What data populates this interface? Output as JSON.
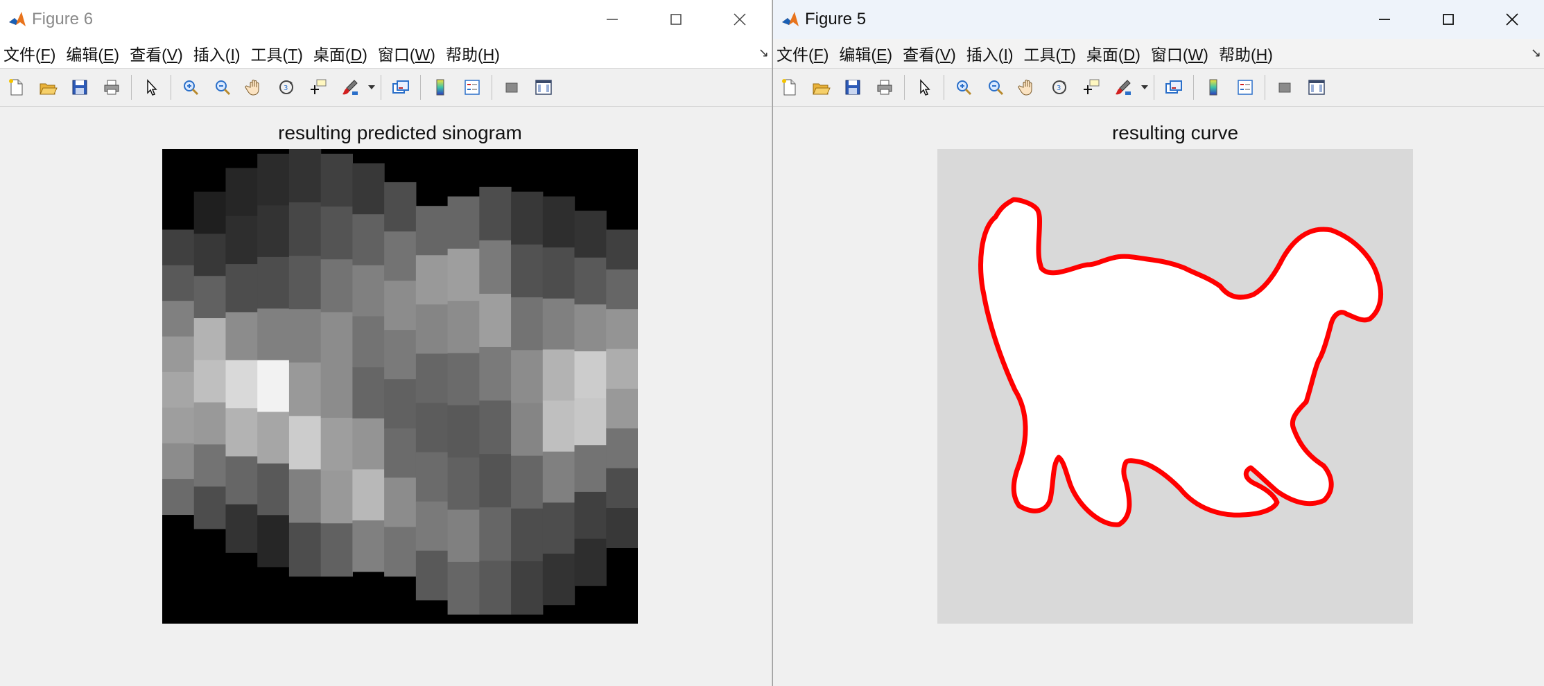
{
  "left_window": {
    "title": "Figure 6",
    "menu": [
      {
        "pre": "文件(",
        "key": "F",
        "post": ")"
      },
      {
        "pre": "编辑(",
        "key": "E",
        "post": ")"
      },
      {
        "pre": "查看(",
        "key": "V",
        "post": ")"
      },
      {
        "pre": "插入(",
        "key": "I",
        "post": ")"
      },
      {
        "pre": "工具(",
        "key": "T",
        "post": ")"
      },
      {
        "pre": "桌面(",
        "key": "D",
        "post": ")"
      },
      {
        "pre": "窗口(",
        "key": "W",
        "post": ")"
      },
      {
        "pre": "帮助(",
        "key": "H",
        "post": ")"
      }
    ],
    "plot_title": "resulting predicted sinogram",
    "sinogram": {
      "colormap": "gray",
      "columns": [
        {
          "top": 0.17,
          "bottom": 0.77,
          "bands": [
            0.25,
            0.35,
            0.5,
            0.6,
            0.65,
            0.62,
            0.55,
            0.42
          ]
        },
        {
          "top": 0.09,
          "bottom": 0.8,
          "bands": [
            0.12,
            0.22,
            0.38,
            0.7,
            0.75,
            0.6,
            0.45,
            0.3
          ]
        },
        {
          "top": 0.04,
          "bottom": 0.85,
          "bands": [
            0.15,
            0.18,
            0.3,
            0.55,
            0.85,
            0.7,
            0.4,
            0.2
          ]
        },
        {
          "top": 0.01,
          "bottom": 0.88,
          "bands": [
            0.17,
            0.2,
            0.3,
            0.5,
            0.95,
            0.65,
            0.35,
            0.15
          ]
        },
        {
          "top": 0.0,
          "bottom": 0.9,
          "bands": [
            0.2,
            0.28,
            0.35,
            0.5,
            0.6,
            0.8,
            0.5,
            0.3
          ]
        },
        {
          "top": 0.01,
          "bottom": 0.9,
          "bands": [
            0.25,
            0.33,
            0.45,
            0.55,
            0.55,
            0.62,
            0.6,
            0.38
          ]
        },
        {
          "top": 0.03,
          "bottom": 0.89,
          "bands": [
            0.22,
            0.38,
            0.5,
            0.45,
            0.4,
            0.58,
            0.72,
            0.5
          ]
        },
        {
          "top": 0.07,
          "bottom": 0.9,
          "bands": [
            0.3,
            0.45,
            0.55,
            0.48,
            0.38,
            0.42,
            0.55,
            0.45
          ]
        },
        {
          "top": 0.12,
          "bottom": 0.95,
          "bands": [
            0.4,
            0.6,
            0.52,
            0.4,
            0.36,
            0.42,
            0.48,
            0.35
          ]
        },
        {
          "top": 0.1,
          "bottom": 0.98,
          "bands": [
            0.4,
            0.62,
            0.55,
            0.42,
            0.35,
            0.38,
            0.5,
            0.4
          ]
        },
        {
          "top": 0.08,
          "bottom": 0.98,
          "bands": [
            0.3,
            0.48,
            0.62,
            0.48,
            0.38,
            0.33,
            0.4,
            0.35
          ]
        },
        {
          "top": 0.09,
          "bottom": 0.98,
          "bands": [
            0.22,
            0.32,
            0.45,
            0.55,
            0.52,
            0.4,
            0.3,
            0.25
          ]
        },
        {
          "top": 0.1,
          "bottom": 0.96,
          "bands": [
            0.18,
            0.3,
            0.5,
            0.7,
            0.75,
            0.5,
            0.3,
            0.2
          ]
        },
        {
          "top": 0.13,
          "bottom": 0.92,
          "bands": [
            0.2,
            0.35,
            0.55,
            0.8,
            0.78,
            0.45,
            0.25,
            0.18
          ]
        },
        {
          "top": 0.17,
          "bottom": 0.84,
          "bands": [
            0.25,
            0.4,
            0.58,
            0.68,
            0.6,
            0.45,
            0.3,
            0.22
          ]
        }
      ]
    }
  },
  "right_window": {
    "title": "Figure 5",
    "menu": [
      {
        "pre": "文件(",
        "key": "F",
        "post": ")"
      },
      {
        "pre": "编辑(",
        "key": "E",
        "post": ")"
      },
      {
        "pre": "查看(",
        "key": "V",
        "post": ")"
      },
      {
        "pre": "插入(",
        "key": "I",
        "post": ")"
      },
      {
        "pre": "工具(",
        "key": "T",
        "post": ")"
      },
      {
        "pre": "桌面(",
        "key": "D",
        "post": ")"
      },
      {
        "pre": "窗口(",
        "key": "W",
        "post": ")"
      },
      {
        "pre": "帮助(",
        "key": "H",
        "post": ")"
      }
    ],
    "plot_title": "resulting curve",
    "curve_color": "#ff0000",
    "fill_color": "#ffffff",
    "background_color": "#d9d9d9"
  },
  "toolbar_icons": [
    "new-figure-icon",
    "open-file-icon",
    "save-icon",
    "print-icon",
    "|",
    "pointer-icon",
    "|",
    "zoom-in-icon",
    "zoom-out-icon",
    "pan-icon",
    "rotate-3d-icon",
    "data-cursor-icon",
    "brush-icon",
    "brush-dropdown",
    "|",
    "link-plot-icon",
    "|",
    "colorbar-icon",
    "legend-icon",
    "|",
    "hide-plot-tools-icon",
    "show-plot-tools-icon"
  ]
}
